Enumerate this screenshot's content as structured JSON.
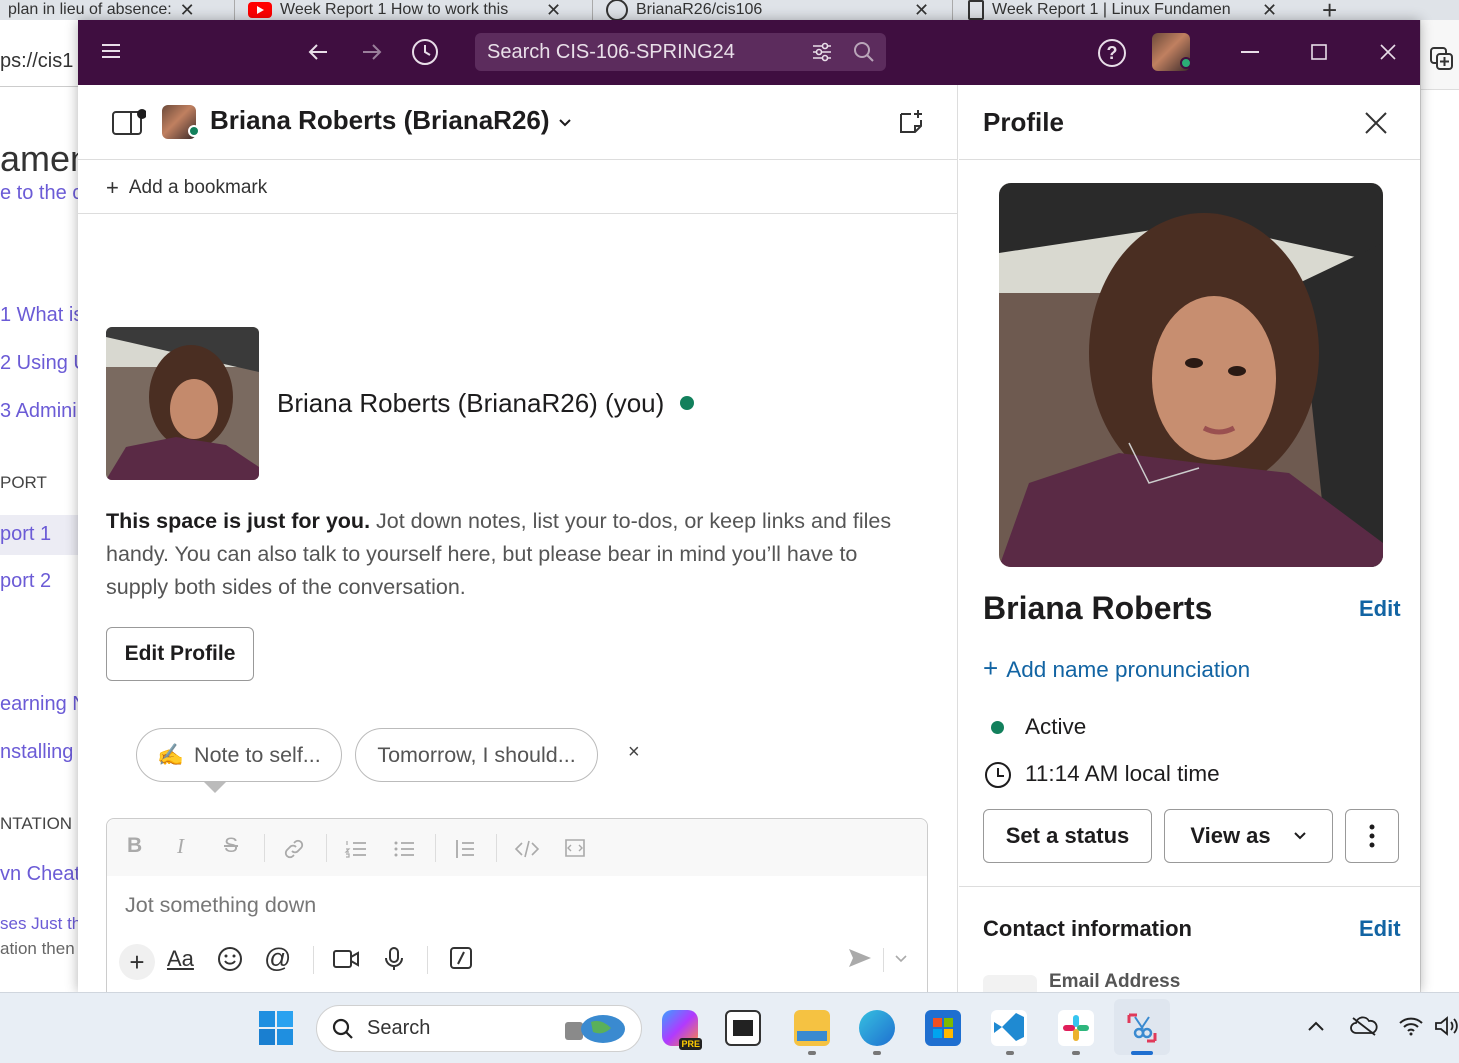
{
  "browser": {
    "tabs": [
      {
        "label": "plan in lieu of absence:"
      },
      {
        "label": "Week Report 1 How to work this"
      },
      {
        "label": "BrianaR26/cis106"
      },
      {
        "label": "Week Report 1 | Linux Fundamen"
      }
    ],
    "new_tab": "+",
    "url_fragment": "ps://cis1",
    "page_fragments": {
      "heading": "amen",
      "subheading": "e to the c",
      "item1": "1 What is",
      "item2": "2 Using U",
      "item3": "3 Admini",
      "section1": "PORT",
      "report1": "port 1",
      "report2": "port 2",
      "learning": "earning N",
      "installing": "nstalling",
      "section2": "NTATION",
      "cheat": "vn Cheat",
      "just": "ses Just th",
      "ation": "ation then"
    }
  },
  "titlebar": {
    "search_placeholder": "Search CIS-106-SPRING24",
    "help_label": "?"
  },
  "channel": {
    "title": "Briana Roberts (BrianaR26)",
    "bookmark_label": "Add a bookmark",
    "intro_name": "Briana Roberts (BrianaR26) (you)",
    "intro_bold": "This space is just for you.",
    "intro_rest": " Jot down notes, list your to-dos, or keep links and files handy. You can also talk to yourself here, but please bear in mind you’ll have to supply both sides of the conversation.",
    "edit_profile_label": "Edit Profile",
    "chips": [
      {
        "emoji": "✍️",
        "label": "Note to self..."
      },
      {
        "label": "Tomorrow, I should..."
      }
    ],
    "chip_close": "×",
    "composer_placeholder": "Jot something down"
  },
  "profile": {
    "title": "Profile",
    "name": "Briana Roberts",
    "edit_label": "Edit",
    "pronunciation_label": "Add name pronunciation",
    "status": "Active",
    "local_time": "11:14 AM local time",
    "set_status_label": "Set a status",
    "view_as_label": "View as",
    "contact_heading": "Contact information",
    "contact_edit_label": "Edit",
    "email_label": "Email Address"
  },
  "taskbar": {
    "search_label": "Search"
  },
  "colors": {
    "aubergine": "#3f0e40",
    "link": "#1264a3",
    "presence": "#12805c"
  }
}
